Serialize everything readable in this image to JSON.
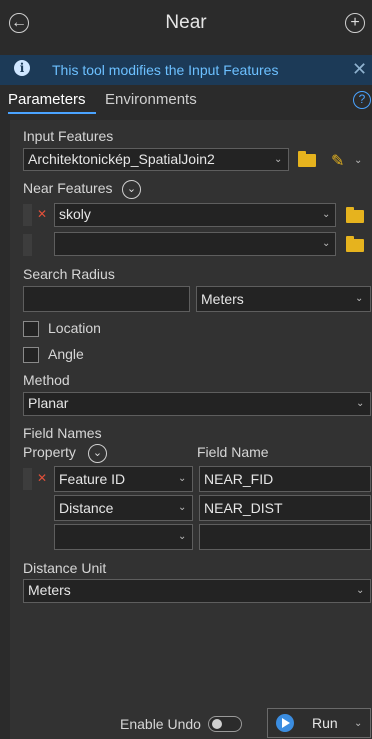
{
  "header": {
    "title": "Near",
    "back_icon": "back-arrow-icon",
    "add_icon": "add-icon"
  },
  "banner": {
    "message": "This tool modifies the Input Features",
    "icon": "info-icon"
  },
  "tabs": {
    "parameters": "Parameters",
    "environments": "Environments"
  },
  "form": {
    "input_features_label": "Input Features",
    "input_features_value": "Architektonickép_SpatialJoin2",
    "near_features_label": "Near Features",
    "near_features": [
      {
        "value": "skoly"
      },
      {
        "value": ""
      }
    ],
    "search_radius_label": "Search Radius",
    "search_radius_value": "",
    "search_radius_unit": "Meters",
    "location_label": "Location",
    "location_checked": false,
    "angle_label": "Angle",
    "angle_checked": false,
    "method_label": "Method",
    "method_value": "Planar",
    "field_names_label": "Field Names",
    "property_header": "Property",
    "field_name_header": "Field Name",
    "field_rows": [
      {
        "property": "Feature ID",
        "field_name": "NEAR_FID"
      },
      {
        "property": "Distance",
        "field_name": "NEAR_DIST"
      },
      {
        "property": "",
        "field_name": ""
      }
    ],
    "distance_unit_label": "Distance Unit",
    "distance_unit_value": "Meters"
  },
  "footer": {
    "enable_undo_label": "Enable Undo",
    "enable_undo_on": false,
    "run_label": "Run"
  },
  "colors": {
    "accent": "#4aa3ff",
    "banner_bg": "#1c3a57",
    "folder": "#e6b31e",
    "remove": "#e0503a"
  }
}
